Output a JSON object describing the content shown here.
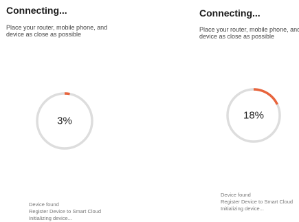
{
  "screens": [
    {
      "title": "Connecting...",
      "instruction_line1": "Place your router, mobile phone, and",
      "instruction_line2": "device as close as possible",
      "progress": 3,
      "progress_label": "3%",
      "status_lines": [
        "Device found",
        "Register Device to Smart Cloud",
        "Initializing device..."
      ]
    },
    {
      "title": "Connecting...",
      "instruction_line1": "Place your router, mobile phone, and",
      "instruction_line2": "device as close as possible",
      "progress": 18,
      "progress_label": "18%",
      "status_lines": [
        "Device found",
        "Register Device to Smart Cloud",
        "Initializing device..."
      ]
    }
  ],
  "colors": {
    "progress_accent": "#e8643c",
    "track": "#dddddd"
  }
}
